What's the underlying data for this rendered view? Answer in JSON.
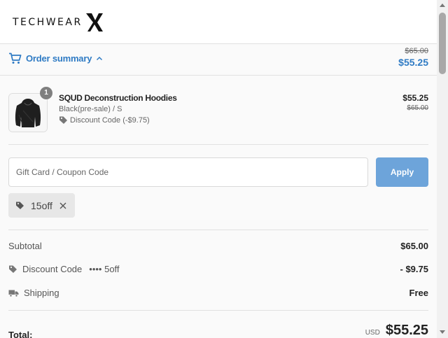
{
  "brand": {
    "name": "TECHWEAR",
    "icon": "techwear-x-logo"
  },
  "order_summary": {
    "toggle_label": "Order summary",
    "toggle_icon": "cart-icon",
    "original_total": "$65.00",
    "discounted_total": "$55.25"
  },
  "line_item": {
    "quantity": "1",
    "title": "SQUD Deconstruction Hoodies",
    "variant": "Black(pre-sale) / S",
    "discount_label": "Discount Code (-$9.75)",
    "price": "$55.25",
    "original_price": "$65.00"
  },
  "coupon": {
    "placeholder": "Gift Card / Coupon Code",
    "apply_label": "Apply",
    "applied_code": "15off"
  },
  "totals": {
    "subtotal_label": "Subtotal",
    "subtotal_value": "$65.00",
    "discount_label": "Discount Code",
    "discount_code": "•••• 5off",
    "discount_value": "- $9.75",
    "shipping_label": "Shipping",
    "shipping_value": "Free",
    "total_label": "Total:",
    "currency": "USD",
    "total_value": "$55.25"
  },
  "colors": {
    "accent": "#2f7bc4",
    "apply_button": "#6da4da",
    "chip_bg": "#e7e7e7"
  }
}
